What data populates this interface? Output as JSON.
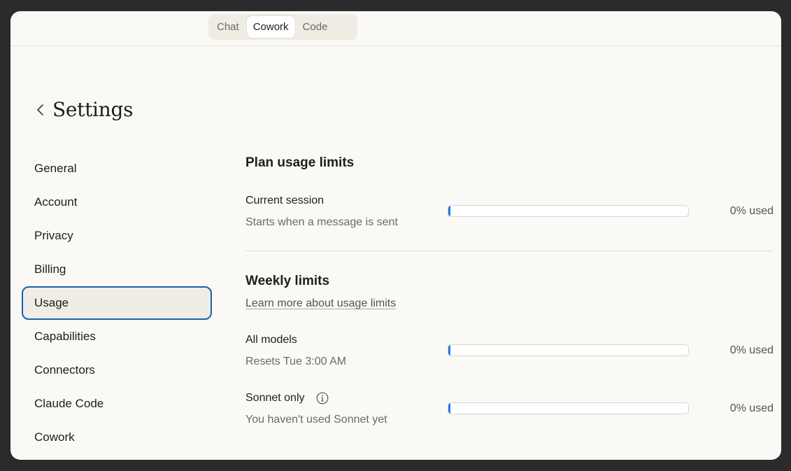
{
  "mode_tabs": [
    {
      "label": "Chat",
      "active": false
    },
    {
      "label": "Cowork",
      "active": true
    },
    {
      "label": "Code",
      "active": false
    }
  ],
  "header": {
    "title": "Settings",
    "back_icon": "chevron-left-icon"
  },
  "sidebar": {
    "items": [
      {
        "label": "General"
      },
      {
        "label": "Account"
      },
      {
        "label": "Privacy"
      },
      {
        "label": "Billing"
      },
      {
        "label": "Usage",
        "active": true
      },
      {
        "label": "Capabilities"
      },
      {
        "label": "Connectors"
      },
      {
        "label": "Claude Code"
      },
      {
        "label": "Cowork"
      }
    ]
  },
  "plan": {
    "title": "Plan usage limits",
    "current_session": {
      "label": "Current session",
      "sub": "Starts when a message is sent",
      "used_fraction": 0.0,
      "pct_text": "0% used"
    }
  },
  "weekly": {
    "title": "Weekly limits",
    "link": "Learn more about usage limits",
    "all_models": {
      "label": "All models",
      "sub": "Resets Tue 3:00 AM",
      "used_fraction": 0.0,
      "pct_text": "0% used"
    },
    "sonnet": {
      "label": "Sonnet only",
      "sub": "You haven't used Sonnet yet",
      "used_fraction": 0.0,
      "pct_text": "0% used",
      "info_icon": "info-icon"
    }
  },
  "colors": {
    "accent": "#1f7ae0",
    "focus_ring": "#1a5fb4",
    "background": "#faf9f5"
  }
}
